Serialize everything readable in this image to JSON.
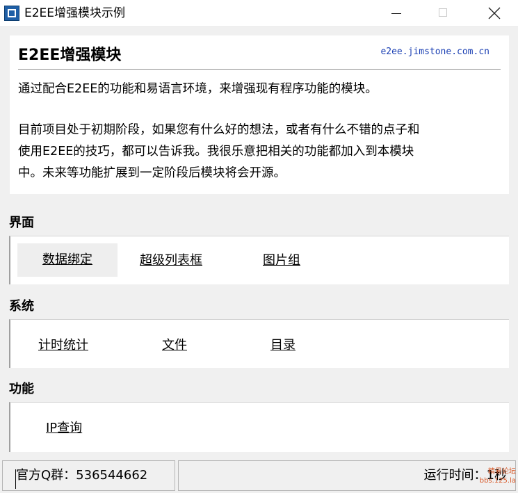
{
  "window": {
    "title": "E2EE增强模块示例",
    "icon": "app-icon",
    "controls": [
      "minimize-icon",
      "maximize-icon",
      "close-icon"
    ]
  },
  "intro": {
    "title": "E2EE增强模块",
    "link": "e2ee.jimstone.com.cn",
    "paragraph1": "通过配合E2EE的功能和易语言环境，来增强现有程序功能的模块。",
    "paragraph2_lines": [
      "目前项目处于初期阶段，如果您有什么好的想法，或者有什么不错的点子和",
      "使用E2EE的技巧，都可以告诉我。我很乐意把相关的功能都加入到本模块",
      "中。未来等功能扩展到一定阶段后模块将会开源。"
    ]
  },
  "sections": {
    "ui": {
      "label": "界面",
      "items": [
        "数据绑定",
        "超级列表框",
        "图片组"
      ]
    },
    "system": {
      "label": "系统",
      "items": [
        "计时统计",
        "文件",
        "目录"
      ]
    },
    "features": {
      "label": "功能",
      "items": [
        "IP查询"
      ]
    }
  },
  "statusbar": {
    "qq_group": "官方Q群：536544662",
    "runtime": "运行时间：1秒"
  },
  "watermark": {
    "line1": "精易论坛",
    "line2": "bbs.125.la"
  },
  "colors": {
    "link": "#1a3fb3",
    "panel_bg": "#ffffff",
    "window_bg": "#f0f0f0"
  }
}
